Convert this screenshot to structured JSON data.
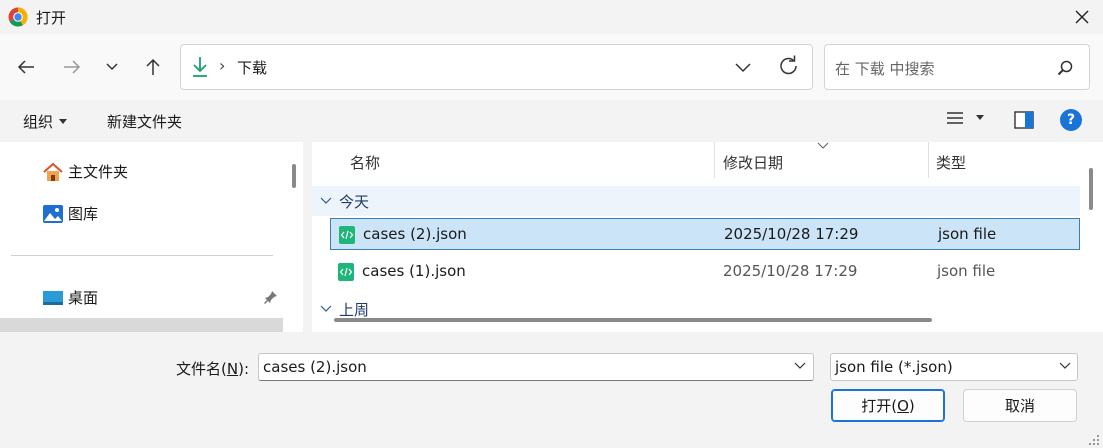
{
  "window": {
    "title": "打开"
  },
  "address": {
    "location": "下载",
    "separator": "›"
  },
  "search": {
    "placeholder": "在 下载 中搜索"
  },
  "toolbar": {
    "organize_label": "组织",
    "new_folder_label": "新建文件夹",
    "help_label": "?"
  },
  "nav_pane": {
    "items": [
      {
        "label": "主文件夹",
        "icon": "home-icon"
      },
      {
        "label": "图库",
        "icon": "gallery-icon"
      },
      {
        "label": "桌面",
        "icon": "desktop-icon",
        "pinned": true
      }
    ]
  },
  "file_list": {
    "columns": [
      "名称",
      "修改日期",
      "类型"
    ],
    "groups": [
      {
        "label": "今天",
        "files": [
          {
            "name": "cases (2).json",
            "modified": "2025/10/28 17:29",
            "type": "json file",
            "selected": true
          },
          {
            "name": "cases (1).json",
            "modified": "2025/10/28 17:29",
            "type": "json file",
            "selected": false
          }
        ]
      },
      {
        "label": "上周",
        "files": []
      }
    ]
  },
  "bottom": {
    "filename_label_pre": "文件名(",
    "filename_label_key": "N",
    "filename_label_post": "):",
    "filename_value": "cases (2).json",
    "filetype_value": "json file (*.json)",
    "open_label_pre": "打开(",
    "open_label_key": "O",
    "open_label_post": ")",
    "cancel_label": "取消"
  },
  "colors": {
    "accent": "#1a73d9",
    "selection": "#cce4f7",
    "group_header": "#eef4fb"
  }
}
